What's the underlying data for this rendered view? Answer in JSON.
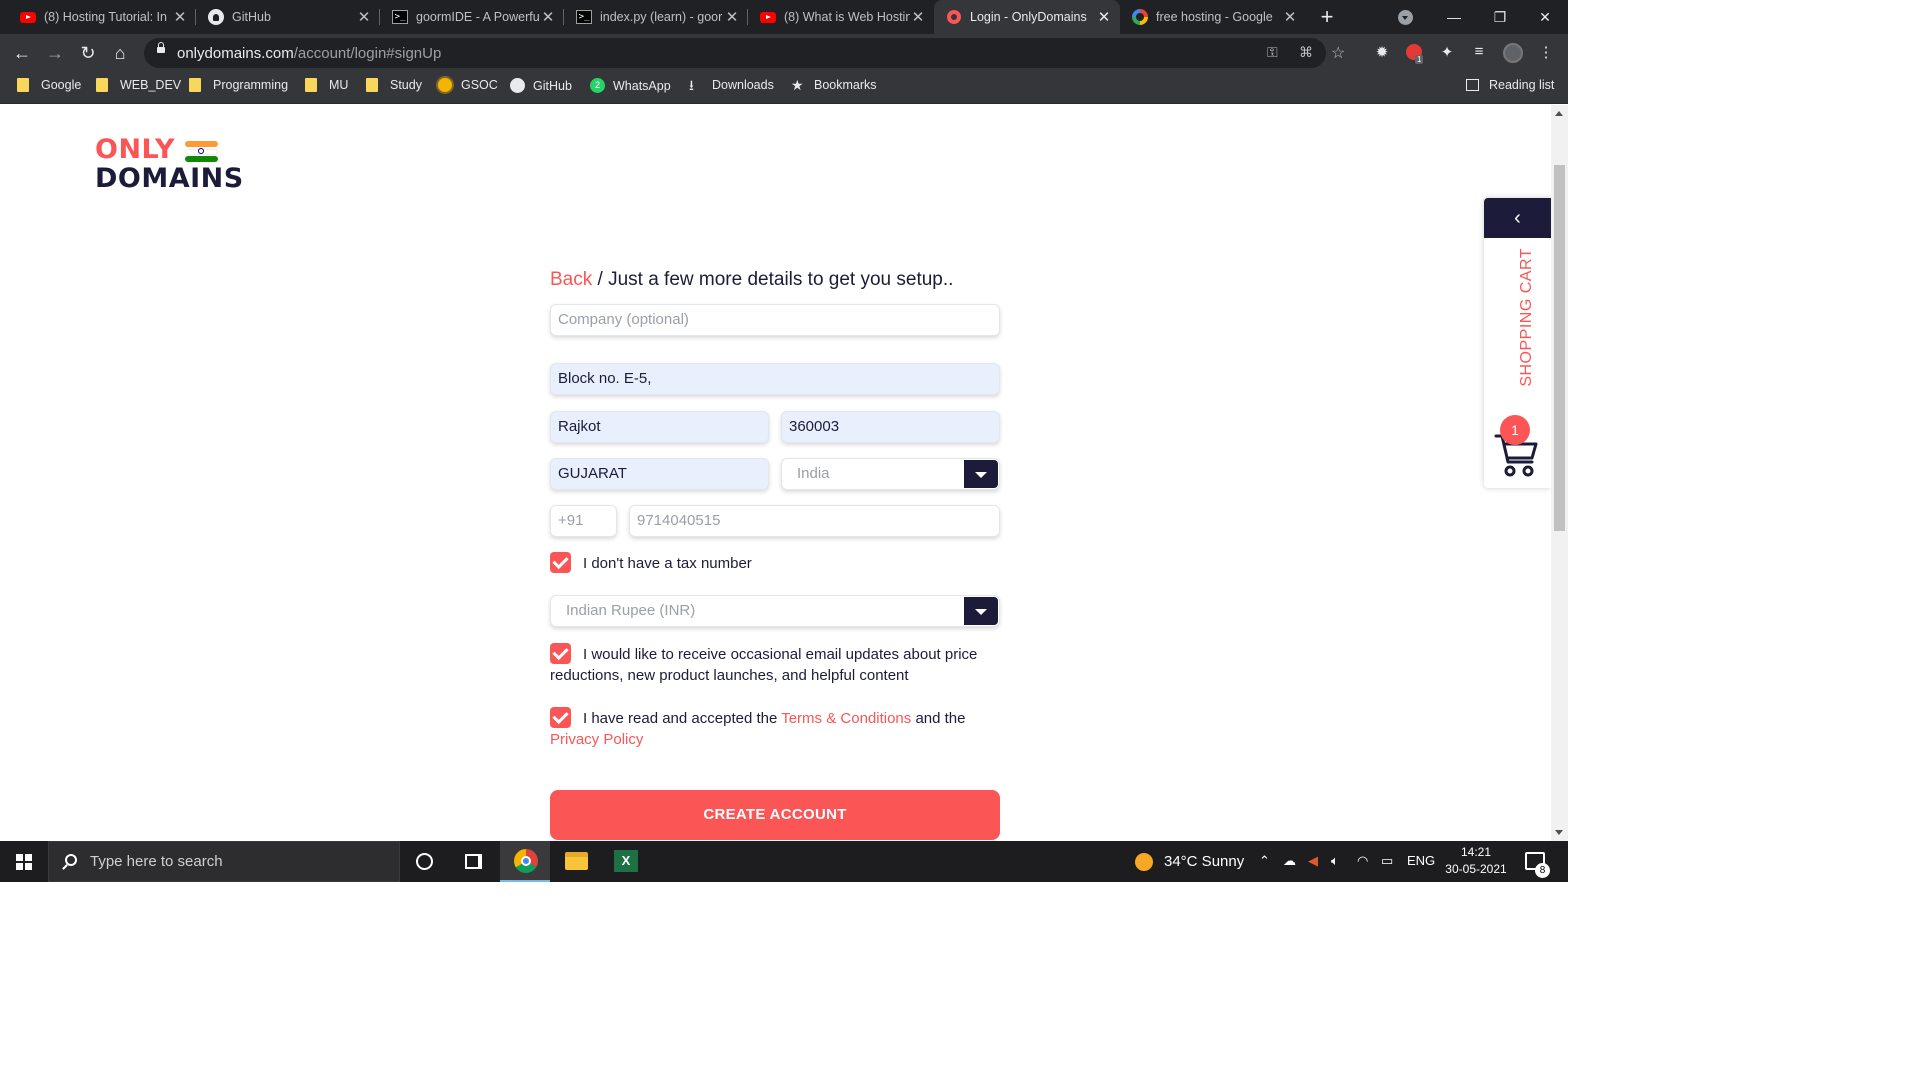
{
  "browser": {
    "tabs": [
      {
        "title": "(8) Hosting Tutorial: In",
        "icon": "youtube-icon"
      },
      {
        "title": "GitHub",
        "icon": "github-icon"
      },
      {
        "title": "goormIDE - A Powerfu",
        "icon": "terminal-icon"
      },
      {
        "title": "index.py (learn) - goor",
        "icon": "terminal-icon"
      },
      {
        "title": "(8) What is Web Hostin",
        "icon": "youtube-icon"
      },
      {
        "title": "Login - OnlyDomains",
        "icon": "onlydomains-icon",
        "active": true
      },
      {
        "title": "free hosting - Google",
        "icon": "google-icon"
      }
    ],
    "url_host": "onlydomains.com",
    "url_path": "/account/login#signUp",
    "extension_badge": "1",
    "bookmarks": [
      {
        "label": "Google",
        "icon": "folder-icon"
      },
      {
        "label": "WEB_DEV",
        "icon": "folder-icon"
      },
      {
        "label": "Programming",
        "icon": "folder-icon"
      },
      {
        "label": "MU",
        "icon": "folder-icon"
      },
      {
        "label": "Study",
        "icon": "folder-icon"
      },
      {
        "label": "GSOC",
        "icon": "gsoc-icon"
      },
      {
        "label": "GitHub",
        "icon": "github-icon"
      },
      {
        "label": "WhatsApp",
        "icon": "whatsapp-icon"
      },
      {
        "label": "Downloads",
        "icon": "download-icon"
      },
      {
        "label": "Bookmarks",
        "icon": "star-icon"
      }
    ],
    "reading_list": "Reading list"
  },
  "logo": {
    "top": "ONLY",
    "bottom": "DOMAINS"
  },
  "form": {
    "back_link": "Back",
    "heading": " / Just a few more details to get you setup..",
    "company_placeholder": "Company (optional)",
    "address": "Block no. E-5,",
    "city": "Rajkot",
    "postcode": "360003",
    "state": "GUJARAT",
    "country": "India",
    "phone_code": "+91",
    "phone": "9714040515",
    "tax_label": "I don't have a tax number",
    "tax_checked": true,
    "currency": "Indian Rupee (INR)",
    "email_updates_label": "I would like to receive occasional email updates about price reductions, new product launches, and helpful content",
    "email_updates_checked": true,
    "terms_prefix": "I have read and accepted the ",
    "terms_link": "Terms & Conditions",
    "terms_middle": " and the",
    "privacy_link": "Privacy Policy",
    "terms_checked": true,
    "submit_label": "CREATE ACCOUNT"
  },
  "cart": {
    "label": "SHOPPING CART",
    "count": "1"
  },
  "colors": {
    "accent": "#fb5555",
    "navy": "#1c1c3a"
  },
  "taskbar": {
    "search_placeholder": "Type here to search",
    "weather": "34°C  Sunny",
    "language": "ENG",
    "time": "14:21",
    "date": "30-05-2021",
    "notification_count": "8"
  }
}
